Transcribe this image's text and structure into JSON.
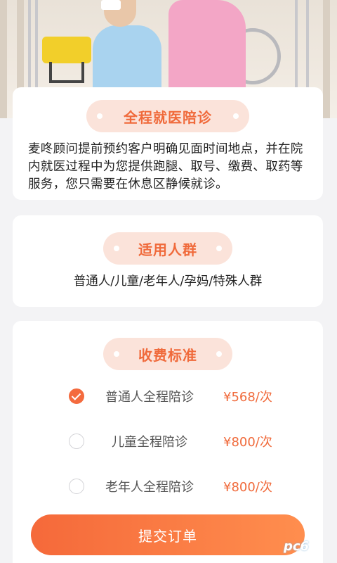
{
  "hero": {
    "image_alt": "nurse assisting patient in wheelchair"
  },
  "intro": {
    "title": "全程就医陪诊",
    "text": "麦咚顾问提前预约客户明确见面时间地点，并在院内就医过程中为您提供跑腿、取号、缴费、取药等服务，您只需要在休息区静候就诊。"
  },
  "people": {
    "title": "适用人群",
    "text": "普通人/儿童/老年人/孕妈/特殊人群"
  },
  "fees": {
    "title": "收费标准",
    "options": [
      {
        "name": "普通人全程陪诊",
        "price": "¥568/次",
        "selected": true
      },
      {
        "name": "儿童全程陪诊",
        "price": "¥800/次",
        "selected": false
      },
      {
        "name": "老年人全程陪诊",
        "price": "¥800/次",
        "selected": false
      }
    ]
  },
  "submit_label": "提交订单",
  "watermark_text": "pc6",
  "colors": {
    "accent": "#f06a3b",
    "pill_bg": "#fbe3da",
    "page_bg": "#f3f3f5"
  }
}
